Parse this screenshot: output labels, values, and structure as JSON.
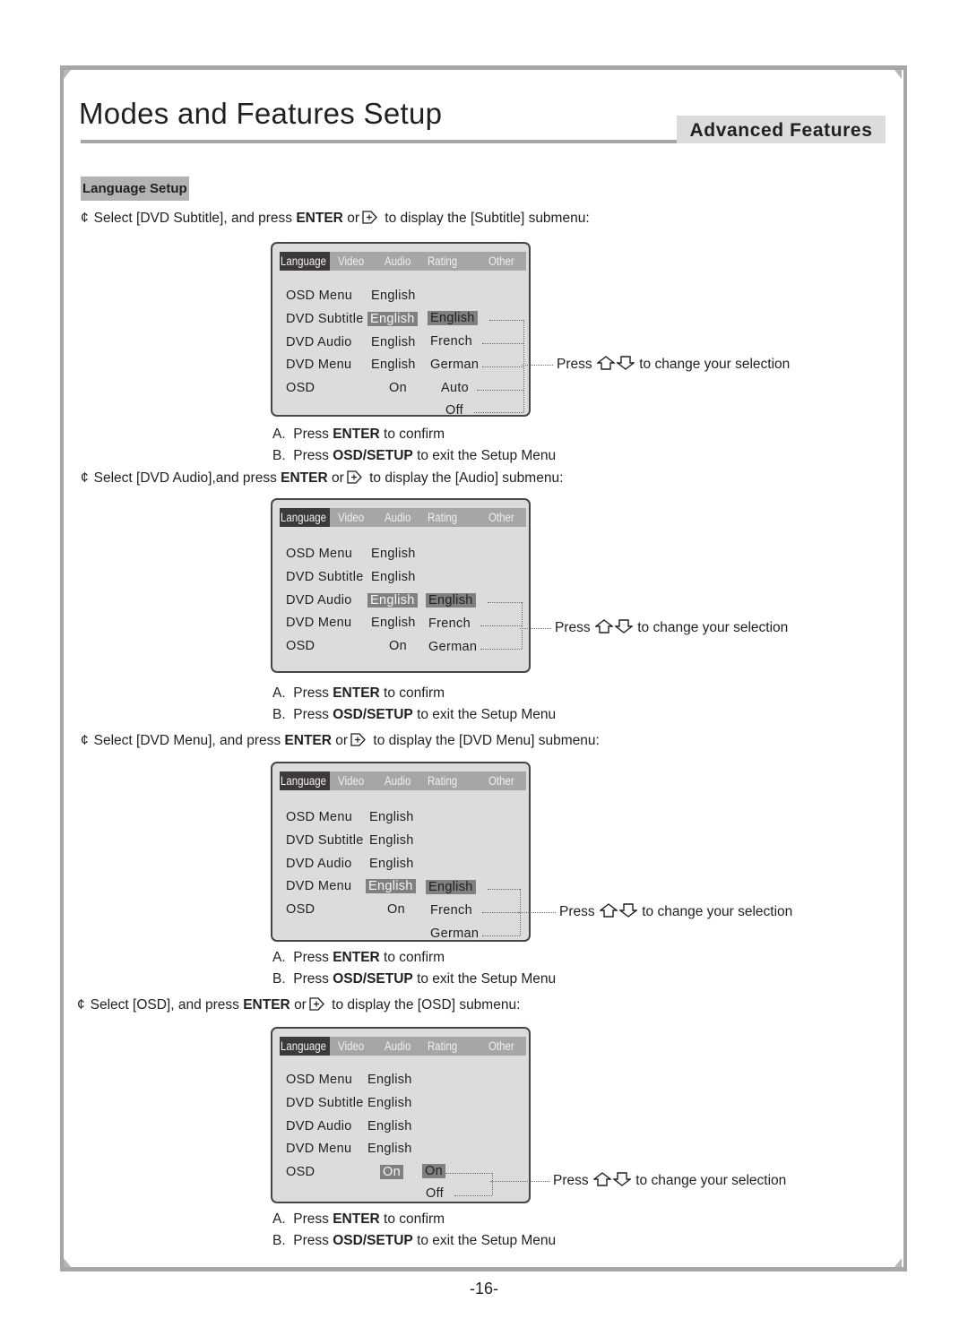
{
  "header": {
    "title": "Modes and Features Setup",
    "section_badge": "Advanced Features"
  },
  "subsection": "Language Setup",
  "common": {
    "bullet": "¢",
    "enter": "ENTER",
    "or": "or",
    "step_a_prefix": "A.  Press ",
    "step_a_key": "ENTER",
    "step_a_suffix": " to confirm",
    "step_b_prefix": "B.  Press ",
    "step_b_key": "OSD/SETUP",
    "step_b_suffix": " to exit the Setup Menu",
    "hint_prefix": "Press",
    "hint_suffix": "to change your selection",
    "tabs": [
      "Language",
      "Video",
      "Audio",
      "Rating",
      "Other"
    ],
    "row_labels": [
      "OSD Menu",
      "DVD Subtitle",
      "DVD Audio",
      "DVD Menu",
      "OSD"
    ],
    "icons": {
      "enter_arrow": "enter-right-arrow-icon",
      "up": "up-arrow-icon",
      "down": "down-arrow-icon"
    }
  },
  "sections": [
    {
      "instruction_pre": "Select [DVD Subtitle], and press ",
      "instruction_post": " to display the [Subtitle] submenu:",
      "values": [
        "English",
        "English",
        "English",
        "English",
        "On"
      ],
      "highlighted_row": 1,
      "options": [
        "English",
        "French",
        "German",
        "Auto",
        "Off"
      ],
      "selected_option": "English"
    },
    {
      "instruction_pre": "Select [DVD Audio],and press ",
      "instruction_post": " to display the [Audio] submenu:",
      "values": [
        "English",
        "English",
        "English",
        "English",
        "On"
      ],
      "highlighted_row": 2,
      "options": [
        "English",
        "French",
        "German"
      ],
      "selected_option": "English"
    },
    {
      "instruction_pre": "Select [DVD Menu], and press ",
      "instruction_post": " to display the [DVD Menu] submenu:",
      "values": [
        "English",
        "English",
        "English",
        "English",
        "On"
      ],
      "highlighted_row": 3,
      "options": [
        "English",
        "French",
        "German"
      ],
      "selected_option": "English"
    },
    {
      "instruction_pre": "Select [OSD], and press ",
      "instruction_post": " to display the [OSD] submenu:",
      "values": [
        "English",
        "English",
        "English",
        "English",
        "On"
      ],
      "highlighted_row": 4,
      "options": [
        "On",
        "Off"
      ],
      "selected_option": "On"
    }
  ],
  "footer": {
    "page_number": "-16-"
  }
}
